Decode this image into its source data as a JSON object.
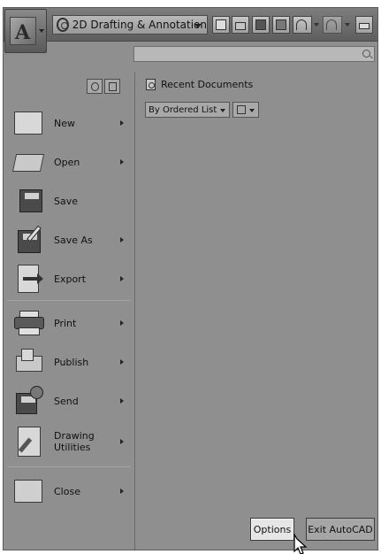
{
  "toolbar": {
    "workspace_label": "2D Drafting & Annotation",
    "quick_access": [
      "new-icon",
      "open-icon",
      "save-icon",
      "save-as-icon",
      "undo-icon",
      "redo-icon",
      "plot-icon"
    ]
  },
  "search": {
    "placeholder": ""
  },
  "menu": {
    "items": [
      {
        "label": "New",
        "icon": "new-document-icon",
        "has_submenu": true
      },
      {
        "label": "Open",
        "icon": "open-folder-icon",
        "has_submenu": true
      },
      {
        "label": "Save",
        "icon": "save-icon",
        "has_submenu": false
      },
      {
        "label": "Save As",
        "icon": "save-as-icon",
        "has_submenu": true
      },
      {
        "label": "Export",
        "icon": "export-icon",
        "has_submenu": true
      },
      {
        "label": "Print",
        "icon": "printer-icon",
        "has_submenu": true
      },
      {
        "label": "Publish",
        "icon": "publish-icon",
        "has_submenu": true
      },
      {
        "label": "Send",
        "icon": "send-icon",
        "has_submenu": true
      },
      {
        "label": "Drawing Utilities",
        "icon": "drawing-utilities-icon",
        "has_submenu": true
      },
      {
        "label": "Close",
        "icon": "close-document-icon",
        "has_submenu": true
      }
    ]
  },
  "recent": {
    "title": "Recent Documents",
    "sort_label": "By Ordered List"
  },
  "footer": {
    "options_label": "Options",
    "exit_label": "Exit AutoCAD"
  }
}
